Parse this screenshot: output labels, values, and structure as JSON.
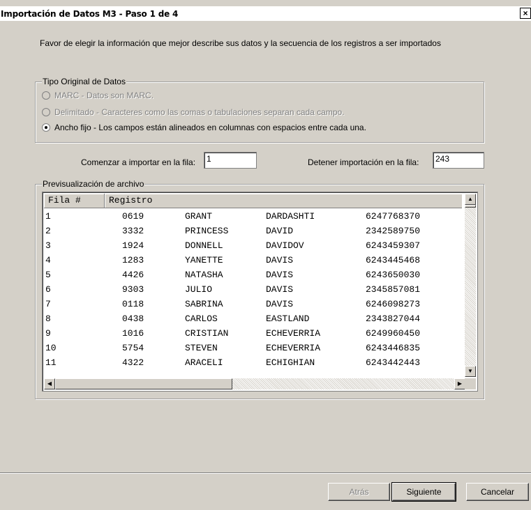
{
  "window": {
    "title": "Importación de Datos M3 - Paso 1 de 4",
    "close_glyph": "×"
  },
  "instruction": "Favor de elegir la información que mejor describe sus datos y la secuencia de los registros a ser importados",
  "data_type_group": {
    "legend": "Tipo Original de Datos",
    "options": [
      {
        "label": "MARC - Datos son MARC.",
        "enabled": false,
        "checked": false
      },
      {
        "label": "Delimitado - Caracteres como las comas o tabulaciones separan cada campo.",
        "enabled": false,
        "checked": false
      },
      {
        "label": "Ancho fijo - Los campos están alineados en columnas con espacios entre cada una.",
        "enabled": true,
        "checked": true
      }
    ]
  },
  "start_row": {
    "label": "Comenzar a importar en la fila:",
    "value": "1"
  },
  "stop_row": {
    "label": "Detener importación en la fila:",
    "value": "243"
  },
  "preview": {
    "legend": "Previsualización de archivo",
    "columns": [
      "Fila #",
      "Registro"
    ],
    "rows": [
      [
        "1",
        "0619",
        "GRANT",
        "DARDASHTI",
        "6247768370"
      ],
      [
        "2",
        "3332",
        "PRINCESS",
        "DAVID",
        "2342589750"
      ],
      [
        "3",
        "1924",
        "DONNELL",
        "DAVIDOV",
        "6243459307"
      ],
      [
        "4",
        "1283",
        "YANETTE",
        "DAVIS",
        "6243445468"
      ],
      [
        "5",
        "4426",
        "NATASHA",
        "DAVIS",
        "6243650030"
      ],
      [
        "6",
        "9303",
        "JULIO",
        "DAVIS",
        "2345857081"
      ],
      [
        "7",
        "0118",
        "SABRINA",
        "DAVIS",
        "6246098273"
      ],
      [
        "8",
        "0438",
        "CARLOS",
        "EASTLAND",
        "2343827044"
      ],
      [
        "9",
        "1016",
        "CRISTIAN",
        "ECHEVERRIA",
        "6249960450"
      ],
      [
        "10",
        "5754",
        "STEVEN",
        "ECHEVERRIA",
        "6243446835"
      ],
      [
        "11",
        "4322",
        "ARACELI",
        "ECHIGHIAN",
        "6243442443"
      ]
    ]
  },
  "buttons": {
    "back": "Atrás",
    "next": "Siguiente",
    "cancel": "Cancelar"
  },
  "icons": {
    "scroll_up": "▲",
    "scroll_down": "▼",
    "scroll_left": "◀",
    "scroll_right": "▶"
  }
}
